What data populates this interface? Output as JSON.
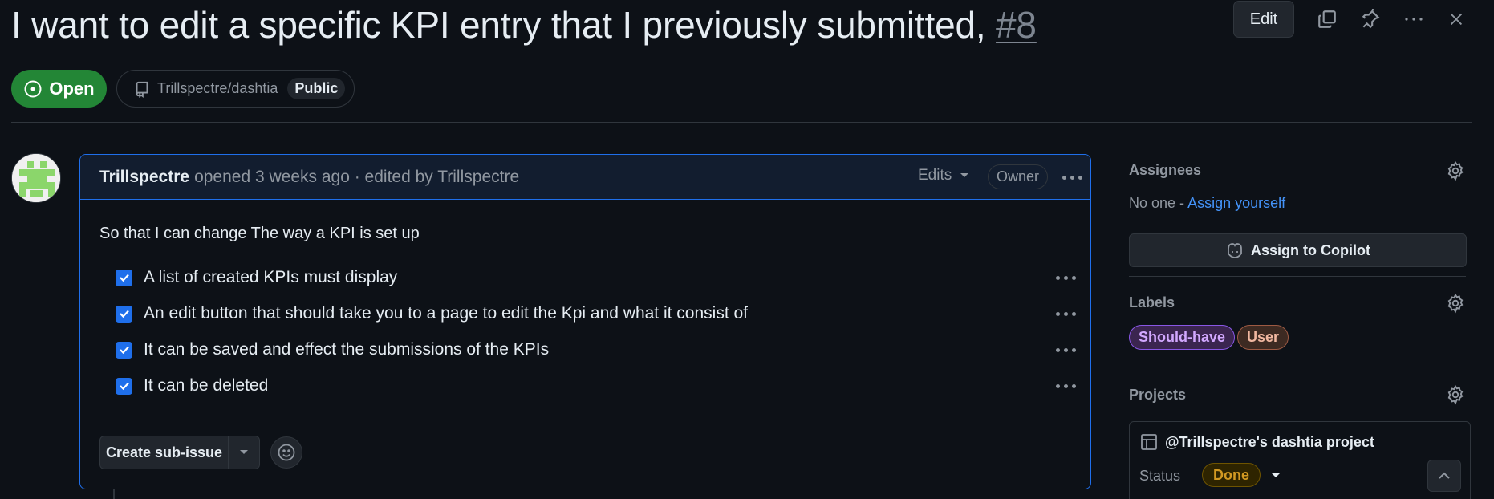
{
  "issue": {
    "title": "I want to edit a specific KPI entry that I previously submitted,",
    "number": "#8",
    "state": "Open",
    "repo": "Trillspectre/dashtia",
    "visibility": "Public"
  },
  "toolbar": {
    "edit_label": "Edit",
    "icons": [
      "copy-icon",
      "pin-icon",
      "more-icon",
      "close-icon"
    ]
  },
  "comment": {
    "author": "Trillspectre",
    "meta": "opened 3 weeks ago · edited by Trillspectre",
    "edits_label": "Edits",
    "owner_label": "Owner",
    "body": "So that I can change The way a KPI is set up",
    "tasks": [
      {
        "label": "A list of created KPIs must display",
        "checked": true
      },
      {
        "label": "An edit button that should take you to a page to edit the Kpi and what it consist of",
        "checked": true
      },
      {
        "label": "It can be saved and effect the submissions of the KPIs",
        "checked": true
      },
      {
        "label": "It can be deleted",
        "checked": true
      }
    ],
    "create_subissue_label": "Create sub-issue"
  },
  "sidebar": {
    "assignees": {
      "heading": "Assignees",
      "none_text": "No one -",
      "assign_yourself": "Assign yourself",
      "copilot_label": "Assign to Copilot"
    },
    "labels": {
      "heading": "Labels",
      "items": [
        {
          "name": "Should-have",
          "color": "#d2a8ff"
        },
        {
          "name": "User",
          "color": "#f0b7a0"
        }
      ]
    },
    "projects": {
      "heading": "Projects",
      "project_name": "@Trillspectre's dashtia project",
      "status_label": "Status",
      "status_value": "Done"
    }
  },
  "colors": {
    "background": "#0d1117",
    "accent_blue": "#1f6feb",
    "open_green": "#238636",
    "link_blue": "#4493f8"
  }
}
